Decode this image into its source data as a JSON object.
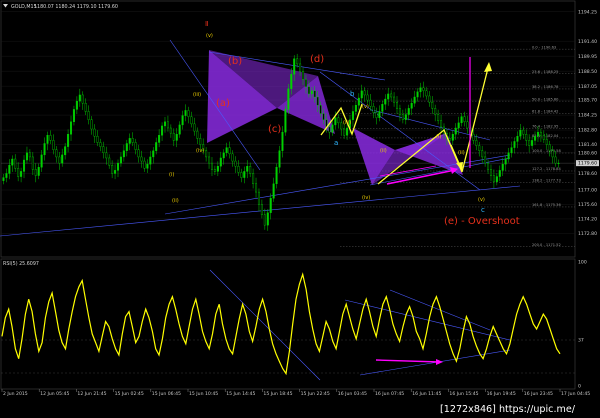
{
  "window": {
    "symbol_title": "GOLD,M15",
    "ohlc_text": "1180.07 1180.24 1179.10 1179.60",
    "indicator_title": "RSI(5) 25.6097",
    "watermark": "[1272x846] https://upic.me/"
  },
  "colors": {
    "background": "#000000",
    "bull_candle": "#00d000",
    "bear_candle": "#00d000",
    "rsi_line": "#ffff00",
    "harmonic_fill": "#8a2be2",
    "trendline": "#4a5aff",
    "wave_label_red": "#e5301c",
    "arrow_yellow": "#ffff33",
    "arrow_magenta": "#ff00ff",
    "price_marker": "#d0d0d0"
  },
  "icons": {
    "menu": "triangle-down-icon"
  },
  "chart_data": [
    {
      "type": "candlestick",
      "title": "GOLD,M15",
      "ylim": [
        1171.0,
        1195.0
      ],
      "y_ticks": [
        1194.25,
        1191.4,
        1189.95,
        1188.5,
        1187.05,
        1185.7,
        1184.25,
        1182.8,
        1181.4,
        1180.6,
        1178.6,
        1177.0,
        1175.6,
        1174.2,
        1172.8
      ],
      "current_price": 1179.6,
      "x_ticks": [
        "2 Jun 2015",
        "12 Jun 05:45",
        "12 Jun 21:45",
        "15 Jun 02:45",
        "15 Jun 06:45",
        "15 Jun 10:45",
        "15 Jun 14:45",
        "15 Jun 18:45",
        "15 Jun 22:45",
        "16 Jun 03:45",
        "16 Jun 07:45",
        "16 Jun 11:45",
        "16 Jun 15:45",
        "16 Jun 19:45",
        "16 Jun 23:45",
        "17 Jun 04:45"
      ],
      "close_series": [
        1178.2,
        1178.6,
        1179.4,
        1180.0,
        1179.1,
        1178.3,
        1178.8,
        1179.9,
        1180.6,
        1180.2,
        1179.0,
        1178.4,
        1179.2,
        1180.4,
        1181.5,
        1182.3,
        1181.8,
        1180.9,
        1180.2,
        1179.6,
        1180.4,
        1181.2,
        1182.4,
        1183.6,
        1184.8,
        1185.6,
        1186.2,
        1185.4,
        1184.6,
        1183.8,
        1182.9,
        1182.2,
        1181.6,
        1181.2,
        1180.6,
        1180.1,
        1179.4,
        1178.6,
        1178.9,
        1179.6,
        1180.2,
        1180.8,
        1181.5,
        1182.0,
        1181.6,
        1180.9,
        1180.2,
        1179.8,
        1179.1,
        1179.5,
        1180.2,
        1180.8,
        1181.6,
        1182.3,
        1183.2,
        1183.6,
        1183.0,
        1182.5,
        1181.8,
        1182.4,
        1183.3,
        1184.2,
        1184.7,
        1184.1,
        1183.4,
        1182.7,
        1182.0,
        1181.4,
        1180.8,
        1180.2,
        1179.6,
        1179.0,
        1178.8,
        1179.3,
        1180.1,
        1180.6,
        1181.1,
        1180.5,
        1179.8,
        1179.3,
        1178.7,
        1178.2,
        1178.8,
        1179.3,
        1178.6,
        1177.6,
        1176.8,
        1175.6,
        1174.6,
        1173.6,
        1174.8,
        1176.2,
        1177.6,
        1179.2,
        1180.8,
        1182.6,
        1184.8,
        1186.8,
        1188.2,
        1189.7,
        1189.2,
        1188.5,
        1187.7,
        1187.0,
        1186.3,
        1186.6,
        1186.0,
        1185.2,
        1184.4,
        1183.8,
        1183.1,
        1182.6,
        1183.3,
        1184.0,
        1183.5,
        1182.9,
        1182.3,
        1183.0,
        1183.8,
        1184.6,
        1185.2,
        1185.9,
        1186.6,
        1186.2,
        1185.7,
        1185.1,
        1184.5,
        1184.0,
        1184.6,
        1185.3,
        1185.8,
        1186.3,
        1186.0,
        1185.5,
        1184.9,
        1184.3,
        1183.8,
        1184.3,
        1184.9,
        1185.4,
        1186.0,
        1186.5,
        1186.9,
        1186.6,
        1186.1,
        1185.5,
        1184.9,
        1184.3,
        1183.7,
        1183.1,
        1182.5,
        1182.0,
        1181.8,
        1182.4,
        1183.0,
        1183.5,
        1184.1,
        1183.6,
        1183.0,
        1182.4,
        1181.8,
        1181.3,
        1180.8,
        1180.2,
        1179.6,
        1179.0,
        1178.4,
        1177.8,
        1178.3,
        1178.9,
        1179.5,
        1180.0,
        1180.6,
        1181.1,
        1181.7,
        1182.2,
        1182.8,
        1182.4,
        1181.8,
        1181.3,
        1181.8,
        1182.2,
        1182.6,
        1182.3,
        1181.9,
        1181.4,
        1180.8,
        1180.2,
        1179.6,
        1179.6
      ]
    },
    {
      "type": "line",
      "title": "RSI(5) 25.6097",
      "ylim": [
        0,
        100
      ],
      "y_ticks": [
        100,
        37,
        0
      ],
      "levels": [
        70,
        30
      ],
      "series": [
        {
          "values": [
            40,
            55,
            62,
            48,
            30,
            22,
            38,
            58,
            70,
            60,
            42,
            28,
            35,
            55,
            68,
            75,
            60,
            45,
            35,
            30,
            46,
            60,
            72,
            80,
            85,
            70,
            55,
            42,
            35,
            28,
            40,
            52,
            48,
            38,
            30,
            25,
            42,
            56,
            60,
            48,
            35,
            40,
            52,
            62,
            55,
            44,
            30,
            25,
            38,
            55,
            66,
            72,
            62,
            50,
            40,
            34,
            48,
            62,
            70,
            58,
            44,
            36,
            30,
            42,
            58,
            66,
            50,
            38,
            30,
            26,
            40,
            54,
            66,
            58,
            44,
            36,
            48,
            62,
            70,
            60,
            46,
            34,
            26,
            20,
            14,
            10,
            28,
            50,
            70,
            82,
            90,
            78,
            60,
            46,
            34,
            28,
            40,
            52,
            46,
            36,
            30,
            44,
            58,
            66,
            56,
            46,
            38,
            50,
            62,
            70,
            60,
            48,
            40,
            54,
            66,
            72,
            62,
            50,
            42,
            36,
            48,
            58,
            64,
            56,
            44,
            38,
            30,
            42,
            56,
            66,
            72,
            64,
            54,
            44,
            34,
            26,
            20,
            30,
            44,
            56,
            50,
            40,
            32,
            26,
            22,
            30,
            40,
            48,
            42,
            36,
            30,
            26,
            34,
            46,
            58,
            66,
            72,
            66,
            58,
            50,
            46,
            52,
            58,
            54,
            46,
            38,
            30,
            26
          ]
        }
      ]
    }
  ],
  "annotations": {
    "wave_labels_red": [
      "(b)",
      "(d)",
      "(a)",
      "(c)",
      "(e) - Overshoot",
      "Ⅱ"
    ],
    "wave_labels_small": [
      "(v)",
      "(iii)",
      "(iv)",
      "(i)",
      "(ii)",
      "(v)",
      "(iii)",
      "(iv)",
      "(ii)",
      "(i)",
      "(v)",
      "(ii)"
    ],
    "wave_labels_cyan": [
      "b",
      "a",
      "c"
    ],
    "fib_levels": [
      "0.0 - 1190.63",
      "23.6 - 1188.25",
      "38.2 - 1186.78",
      "50.0 - 1185.60",
      "61.8 - 1184.42",
      "76.4 - 1182.95",
      "85.4 - 1182.04",
      "100.0 - 1180.58",
      "127.2 - 1178.84",
      "138.2 - 1177.73",
      "161.8 - 1175.36",
      "200.0 - 1171.52"
    ]
  }
}
